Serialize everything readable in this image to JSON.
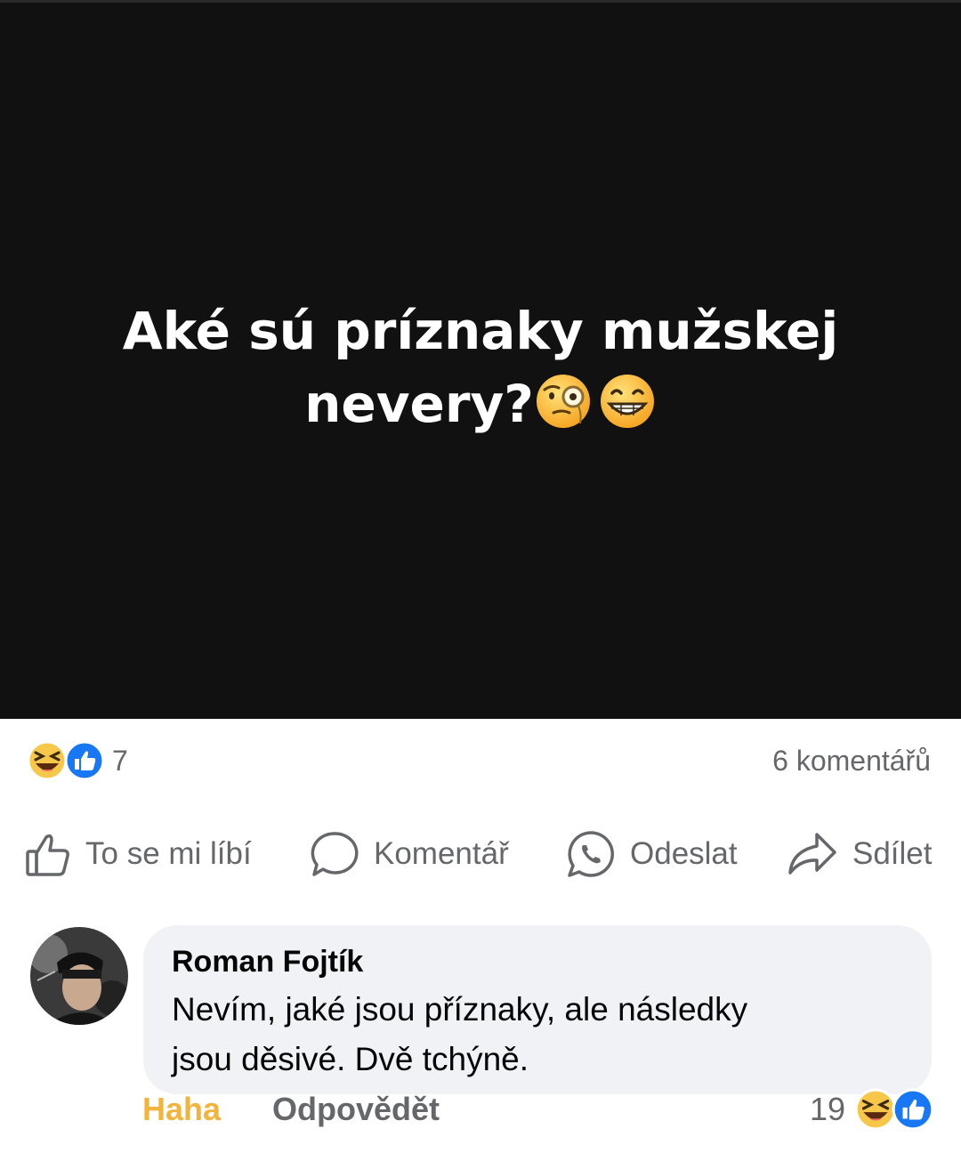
{
  "post": {
    "text_line1": "Aké sú príznaky mužskej",
    "text_line2": "nevery?",
    "emojis": [
      "face-with-monocle-icon",
      "grinning-face-icon"
    ],
    "background": "#111111"
  },
  "stats": {
    "reactions": [
      "haha-icon",
      "like-icon"
    ],
    "reaction_count": "7",
    "comments_count": "6 komentářů"
  },
  "actions": {
    "like": "To se mi líbí",
    "comment": "Komentář",
    "send": "Odeslat",
    "share": "Sdílet"
  },
  "comment": {
    "author": "Roman Fojtík",
    "text_line1": "Nevím, jaké jsou příznaky, ale následky",
    "text_line2": "jsou děsivé. Dvě tchýně.",
    "reaction_label": "Haha",
    "reply_label": "Odpovědět",
    "reaction_count": "19",
    "reactions": [
      "haha-icon",
      "like-icon"
    ]
  },
  "colors": {
    "haha": "#f2b43c",
    "like": "#1877f2",
    "muted": "#65676b",
    "bubble": "#f0f2f5"
  }
}
